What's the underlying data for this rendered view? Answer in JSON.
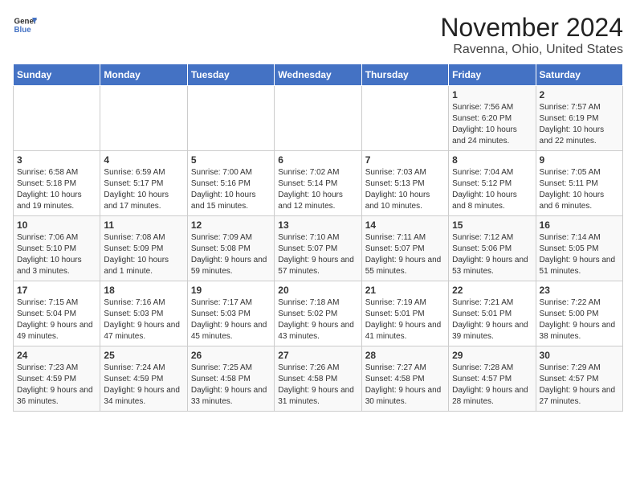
{
  "header": {
    "logo_line1": "General",
    "logo_line2": "Blue",
    "month": "November 2024",
    "location": "Ravenna, Ohio, United States"
  },
  "weekdays": [
    "Sunday",
    "Monday",
    "Tuesday",
    "Wednesday",
    "Thursday",
    "Friday",
    "Saturday"
  ],
  "weeks": [
    [
      {
        "day": "",
        "info": ""
      },
      {
        "day": "",
        "info": ""
      },
      {
        "day": "",
        "info": ""
      },
      {
        "day": "",
        "info": ""
      },
      {
        "day": "",
        "info": ""
      },
      {
        "day": "1",
        "info": "Sunrise: 7:56 AM\nSunset: 6:20 PM\nDaylight: 10 hours and 24 minutes."
      },
      {
        "day": "2",
        "info": "Sunrise: 7:57 AM\nSunset: 6:19 PM\nDaylight: 10 hours and 22 minutes."
      }
    ],
    [
      {
        "day": "3",
        "info": "Sunrise: 6:58 AM\nSunset: 5:18 PM\nDaylight: 10 hours and 19 minutes."
      },
      {
        "day": "4",
        "info": "Sunrise: 6:59 AM\nSunset: 5:17 PM\nDaylight: 10 hours and 17 minutes."
      },
      {
        "day": "5",
        "info": "Sunrise: 7:00 AM\nSunset: 5:16 PM\nDaylight: 10 hours and 15 minutes."
      },
      {
        "day": "6",
        "info": "Sunrise: 7:02 AM\nSunset: 5:14 PM\nDaylight: 10 hours and 12 minutes."
      },
      {
        "day": "7",
        "info": "Sunrise: 7:03 AM\nSunset: 5:13 PM\nDaylight: 10 hours and 10 minutes."
      },
      {
        "day": "8",
        "info": "Sunrise: 7:04 AM\nSunset: 5:12 PM\nDaylight: 10 hours and 8 minutes."
      },
      {
        "day": "9",
        "info": "Sunrise: 7:05 AM\nSunset: 5:11 PM\nDaylight: 10 hours and 6 minutes."
      }
    ],
    [
      {
        "day": "10",
        "info": "Sunrise: 7:06 AM\nSunset: 5:10 PM\nDaylight: 10 hours and 3 minutes."
      },
      {
        "day": "11",
        "info": "Sunrise: 7:08 AM\nSunset: 5:09 PM\nDaylight: 10 hours and 1 minute."
      },
      {
        "day": "12",
        "info": "Sunrise: 7:09 AM\nSunset: 5:08 PM\nDaylight: 9 hours and 59 minutes."
      },
      {
        "day": "13",
        "info": "Sunrise: 7:10 AM\nSunset: 5:07 PM\nDaylight: 9 hours and 57 minutes."
      },
      {
        "day": "14",
        "info": "Sunrise: 7:11 AM\nSunset: 5:07 PM\nDaylight: 9 hours and 55 minutes."
      },
      {
        "day": "15",
        "info": "Sunrise: 7:12 AM\nSunset: 5:06 PM\nDaylight: 9 hours and 53 minutes."
      },
      {
        "day": "16",
        "info": "Sunrise: 7:14 AM\nSunset: 5:05 PM\nDaylight: 9 hours and 51 minutes."
      }
    ],
    [
      {
        "day": "17",
        "info": "Sunrise: 7:15 AM\nSunset: 5:04 PM\nDaylight: 9 hours and 49 minutes."
      },
      {
        "day": "18",
        "info": "Sunrise: 7:16 AM\nSunset: 5:03 PM\nDaylight: 9 hours and 47 minutes."
      },
      {
        "day": "19",
        "info": "Sunrise: 7:17 AM\nSunset: 5:03 PM\nDaylight: 9 hours and 45 minutes."
      },
      {
        "day": "20",
        "info": "Sunrise: 7:18 AM\nSunset: 5:02 PM\nDaylight: 9 hours and 43 minutes."
      },
      {
        "day": "21",
        "info": "Sunrise: 7:19 AM\nSunset: 5:01 PM\nDaylight: 9 hours and 41 minutes."
      },
      {
        "day": "22",
        "info": "Sunrise: 7:21 AM\nSunset: 5:01 PM\nDaylight: 9 hours and 39 minutes."
      },
      {
        "day": "23",
        "info": "Sunrise: 7:22 AM\nSunset: 5:00 PM\nDaylight: 9 hours and 38 minutes."
      }
    ],
    [
      {
        "day": "24",
        "info": "Sunrise: 7:23 AM\nSunset: 4:59 PM\nDaylight: 9 hours and 36 minutes."
      },
      {
        "day": "25",
        "info": "Sunrise: 7:24 AM\nSunset: 4:59 PM\nDaylight: 9 hours and 34 minutes."
      },
      {
        "day": "26",
        "info": "Sunrise: 7:25 AM\nSunset: 4:58 PM\nDaylight: 9 hours and 33 minutes."
      },
      {
        "day": "27",
        "info": "Sunrise: 7:26 AM\nSunset: 4:58 PM\nDaylight: 9 hours and 31 minutes."
      },
      {
        "day": "28",
        "info": "Sunrise: 7:27 AM\nSunset: 4:58 PM\nDaylight: 9 hours and 30 minutes."
      },
      {
        "day": "29",
        "info": "Sunrise: 7:28 AM\nSunset: 4:57 PM\nDaylight: 9 hours and 28 minutes."
      },
      {
        "day": "30",
        "info": "Sunrise: 7:29 AM\nSunset: 4:57 PM\nDaylight: 9 hours and 27 minutes."
      }
    ]
  ]
}
